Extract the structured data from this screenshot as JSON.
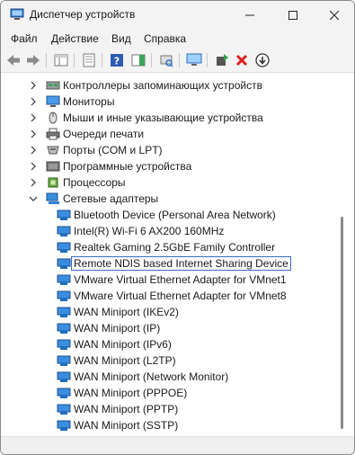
{
  "window": {
    "title": "Диспетчер устройств"
  },
  "menu": {
    "items": [
      {
        "label": "Файл"
      },
      {
        "label": "Действие"
      },
      {
        "label": "Вид"
      },
      {
        "label": "Справка"
      }
    ]
  },
  "toolbar": {
    "buttons": [
      "back-icon",
      "forward-icon",
      "properties-pane-icon",
      "show-hidden-icon",
      "help-icon",
      "properties-icon",
      "update-driver-icon",
      "scan-hardware-icon",
      "add-driver-icon",
      "uninstall-icon",
      "disable-icon"
    ]
  },
  "tree": {
    "categories": [
      {
        "label": "Контроллеры запоминающих устройств",
        "icon": "storage-controller-icon"
      },
      {
        "label": "Мониторы",
        "icon": "monitor-icon"
      },
      {
        "label": "Мыши и иные указывающие устройства",
        "icon": "mouse-icon"
      },
      {
        "label": "Очереди печати",
        "icon": "printer-icon"
      },
      {
        "label": "Порты (COM и LPT)",
        "icon": "port-icon"
      },
      {
        "label": "Программные устройства",
        "icon": "software-device-icon"
      },
      {
        "label": "Процессоры",
        "icon": "processor-icon"
      },
      {
        "label": "Сетевые адаптеры",
        "icon": "network-adapter-icon"
      }
    ],
    "network_adapters": [
      {
        "label": "Bluetooth Device (Personal Area Network)"
      },
      {
        "label": "Intel(R) Wi-Fi 6 AX200 160MHz"
      },
      {
        "label": "Realtek Gaming 2.5GbE Family Controller"
      },
      {
        "label": "Remote NDIS based Internet Sharing Device",
        "selected": true
      },
      {
        "label": "VMware Virtual Ethernet Adapter for VMnet1"
      },
      {
        "label": "VMware Virtual Ethernet Adapter for VMnet8"
      },
      {
        "label": "WAN Miniport (IKEv2)"
      },
      {
        "label": "WAN Miniport (IP)"
      },
      {
        "label": "WAN Miniport (IPv6)"
      },
      {
        "label": "WAN Miniport (L2TP)"
      },
      {
        "label": "WAN Miniport (Network Monitor)"
      },
      {
        "label": "WAN Miniport (PPPOE)"
      },
      {
        "label": "WAN Miniport (PPTP)"
      },
      {
        "label": "WAN Miniport (SSTP)"
      }
    ]
  },
  "colors": {
    "selection_border": "#3a6bd1",
    "network_icon": "#2f7fd6"
  }
}
